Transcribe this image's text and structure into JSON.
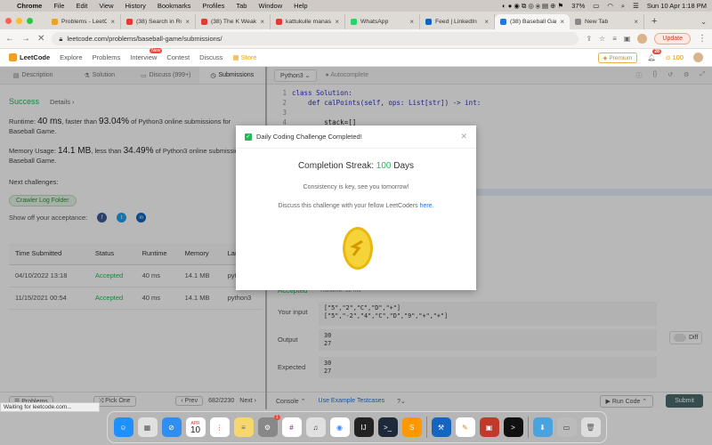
{
  "menubar": {
    "app": "Chrome",
    "items": [
      "File",
      "Edit",
      "View",
      "History",
      "Bookmarks",
      "Profiles",
      "Tab",
      "Window",
      "Help"
    ],
    "battery": "37%",
    "datetime": "Sun 10 Apr  1:18 PM"
  },
  "tabs": [
    {
      "title": "Problems - LeetCode",
      "color": "#f0a020"
    },
    {
      "title": "(38) Search in Ro",
      "color": "#e53935"
    },
    {
      "title": "(38) The K Weake",
      "color": "#e53935"
    },
    {
      "title": "kattukulle manasu",
      "color": "#e53935"
    },
    {
      "title": "WhatsApp",
      "color": "#25d366"
    },
    {
      "title": "Feed | LinkedIn",
      "color": "#0a66c2"
    },
    {
      "title": "(38) Baseball Gam",
      "color": "#2277dd",
      "active": true
    },
    {
      "title": "New Tab",
      "color": "#888888"
    }
  ],
  "address": {
    "url": "leetcode.com/problems/baseball-game/submissions/",
    "update_label": "Update"
  },
  "leetcode_nav": {
    "brand": "LeetCode",
    "items": [
      "Explore",
      "Problems",
      "Interview",
      "Contest",
      "Discuss",
      "Store"
    ],
    "new_badge": "New",
    "premium": "Premium",
    "notifications": "28",
    "coins": "100"
  },
  "left_tabs": [
    "Description",
    "Solution",
    "Discuss (999+)",
    "Submissions"
  ],
  "result": {
    "status": "Success",
    "details": "Details",
    "runtime_label": "Runtime:",
    "runtime": "40 ms",
    "runtime_mid": ", faster than",
    "runtime_pct": "93.04%",
    "runtime_tail": "of Python3 online submissions for Baseball Game.",
    "memory_label": "Memory Usage:",
    "memory": "14.1 MB",
    "memory_mid": ", less than",
    "memory_pct": "34.49%",
    "memory_tail": "of Python3 online submissions for Baseball Game.",
    "next_label": "Next challenges:",
    "next_challenge": "Crawler Log Folder",
    "share_label": "Show off your acceptance:"
  },
  "table": {
    "headers": [
      "Time Submitted",
      "Status",
      "Runtime",
      "Memory",
      "Langu"
    ],
    "rows": [
      [
        "04/10/2022 13:18",
        "Accepted",
        "40 ms",
        "14.1 MB",
        "python3"
      ],
      [
        "11/15/2021 00:54",
        "Accepted",
        "40 ms",
        "14.1 MB",
        "python3"
      ]
    ]
  },
  "left_footer": {
    "problems": "Problems",
    "pick_one": "Pick One",
    "prev": "Prev",
    "page": "682/2230",
    "next": "Next"
  },
  "editor": {
    "language": "Python3",
    "autocomplete": "Autocomplete",
    "line_numbers": [
      "1",
      "2",
      "3",
      "4"
    ],
    "lines": [
      "class Solution:",
      "    def calPoints(self, ops: List[str]) -> int:",
      "",
      "        stack=[]"
    ]
  },
  "testcase": {
    "accepted": "Accepted",
    "runtime_note": "Runtime: 32 ms",
    "input_label": "Your input",
    "input": [
      "[\"5\",\"2\",\"C\",\"D\",\"+\"]",
      "[\"5\",\"-2\",\"4\",\"C\",\"D\",\"9\",\"+\",\"+\"]"
    ],
    "output_label": "Output",
    "output": [
      "30",
      "27"
    ],
    "expected_label": "Expected",
    "expected": [
      "30",
      "27"
    ],
    "diff": "Diff"
  },
  "right_footer": {
    "console": "Console",
    "example": "Use Example Testcases",
    "run": "Run Code",
    "submit": "Submit"
  },
  "modal": {
    "title": "Daily Coding Challenge Completed!",
    "streak_label": "Completion Streak:",
    "streak_value": "100",
    "streak_unit": "Days",
    "consistency": "Consistency is key, see you tomorrow!",
    "discuss": "Discuss this challenge with your fellow LeetCoders",
    "here": "here."
  },
  "status_bar": "Waiting for leetcode.com...",
  "dock": {
    "calendar_month": "APR",
    "calendar_day": "10",
    "badge": "1"
  }
}
